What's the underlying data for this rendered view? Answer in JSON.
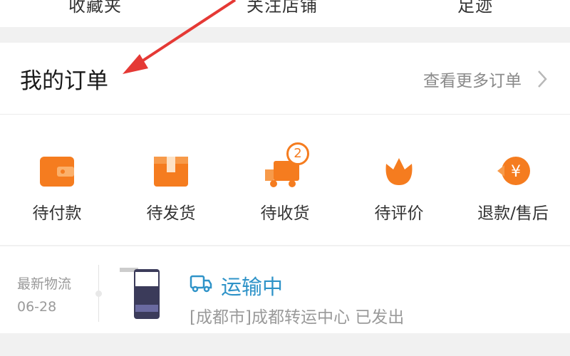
{
  "top_tabs": [
    "收藏夹",
    "关注店铺",
    "足迹"
  ],
  "orders": {
    "title": "我的订单",
    "see_more": "查看更多订单",
    "statuses": [
      {
        "label": "待付款",
        "icon": "wallet-icon"
      },
      {
        "label": "待发货",
        "icon": "package-icon"
      },
      {
        "label": "待收货",
        "icon": "delivery-truck-icon",
        "badge": "2"
      },
      {
        "label": "待评价",
        "icon": "flower-icon"
      },
      {
        "label": "退款/售后",
        "icon": "refund-yen-icon"
      }
    ]
  },
  "logistics": {
    "caption": "最新物流",
    "date": "06-28",
    "status": "运输中",
    "detail": "[成都市]成都转运中心 已发出"
  },
  "colors": {
    "accent_orange": "#f57c1f",
    "logistics_blue": "#2f93c8",
    "arrow_red": "#e53935"
  }
}
